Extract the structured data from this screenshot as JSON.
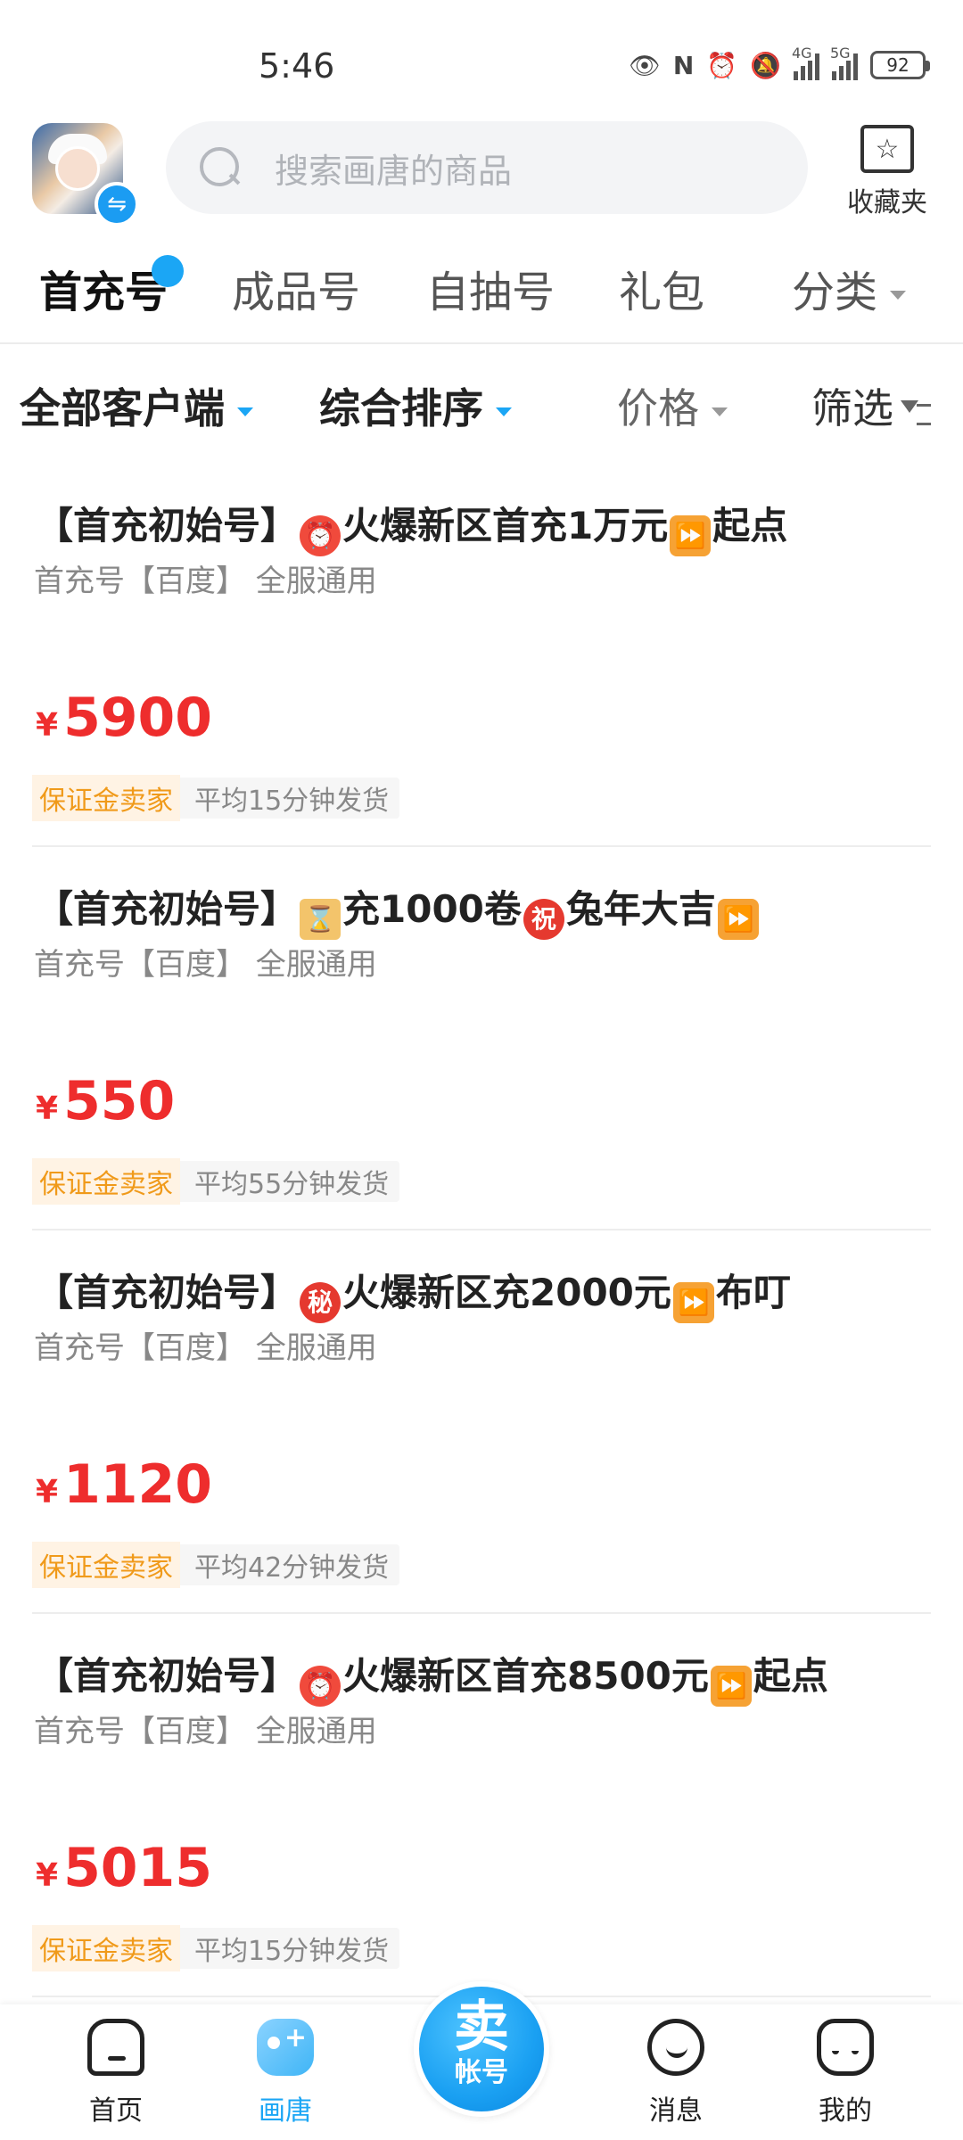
{
  "status_bar": {
    "time": "5:46",
    "net1": "4G",
    "net2": "5G",
    "battery": "92"
  },
  "header": {
    "search_placeholder": "搜索画唐的商品",
    "favorites_label": "收藏夹"
  },
  "tabs": [
    "首充号",
    "成品号",
    "自抽号",
    "礼包",
    "分类"
  ],
  "filters": {
    "client": "全部客户端",
    "sort": "综合排序",
    "price": "价格",
    "filter": "筛选"
  },
  "items": [
    {
      "title_prefix": "【首充初始号】",
      "icon1": "alarm-clock-icon",
      "title_mid": "火爆新区首充1万元",
      "icon2": "fast-forward-icon",
      "title_suffix": "起点",
      "subtitle": "首充号【百度】 全服通用",
      "currency": "¥",
      "price": "5900",
      "tag": "保证金卖家",
      "shipping": "平均15分钟发货"
    },
    {
      "title_prefix": "【首充初始号】",
      "icon1": "hourglass-icon",
      "title_mid": "充1000卷",
      "icon_mid": "祝",
      "title_mid2": "兔年大吉",
      "icon2": "fast-forward-icon",
      "subtitle": "首充号【百度】 全服通用",
      "currency": "¥",
      "price": "550",
      "tag": "保证金卖家",
      "shipping": "平均55分钟发货"
    },
    {
      "title_prefix": "【首充初始号】",
      "icon1_text": "秘",
      "title_mid": "火爆新区充2000元",
      "icon2": "fast-forward-icon",
      "title_suffix": "布叮",
      "subtitle": "首充号【百度】 全服通用",
      "currency": "¥",
      "price": "1120",
      "tag": "保证金卖家",
      "shipping": "平均42分钟发货"
    },
    {
      "title_prefix": "【首充初始号】",
      "icon1": "alarm-clock-icon",
      "title_mid": "火爆新区首充8500元",
      "icon2": "fast-forward-icon",
      "title_suffix": "起点",
      "subtitle": "首充号【百度】 全服通用",
      "currency": "¥",
      "price": "5015",
      "tag": "保证金卖家",
      "shipping": "平均15分钟发货"
    }
  ],
  "bottom_nav": {
    "home": "首页",
    "huatang": "画唐",
    "sell_big": "卖",
    "sell_small": "帐号",
    "messages": "消息",
    "mine": "我的"
  },
  "colors": {
    "accent": "#1ba6f5",
    "price": "#ee2d2d",
    "deposit": "#f09a1a"
  }
}
